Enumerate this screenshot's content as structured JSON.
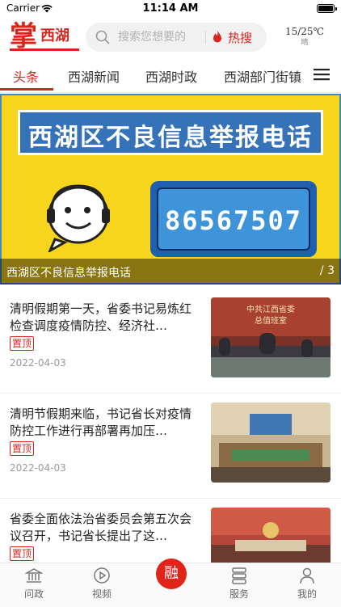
{
  "status_bar": {
    "carrier": "Carrier",
    "time": "11:14 AM"
  },
  "header": {
    "logo_mark": "掌",
    "logo_name": "西湖",
    "search_placeholder": "搜索您想要的",
    "hot_label": "热搜",
    "weather_temp": "15/25℃",
    "weather_cond": "晴"
  },
  "tabs": [
    {
      "label": "头条",
      "active": true
    },
    {
      "label": "西湖新闻",
      "active": false
    },
    {
      "label": "西湖时政",
      "active": false
    },
    {
      "label": "西湖部门街镇",
      "active": false
    }
  ],
  "banner": {
    "title": "西湖区不良信息举报电话",
    "phone": "86567507",
    "caption": "西湖区不良信息举报电话",
    "counter": "/ 3"
  },
  "news": [
    {
      "title": "清明假期第一天，省委书记易炼红检查调度疫情防控、经济社…",
      "badge": "置顶",
      "date": "2022-04-03",
      "thumb_caption": "中共江西省委\n总值班室"
    },
    {
      "title": "清明节假期来临，书记省长对疫情防控工作进行再部署再加压…",
      "badge": "置顶",
      "date": "2022-04-03"
    },
    {
      "title": "省委全面依法治省委员会第五次会议召开，书记省长提出了这…",
      "badge": "置顶",
      "date": ""
    }
  ],
  "tabbar": [
    {
      "label": "问政",
      "icon": "government-building-icon"
    },
    {
      "label": "视频",
      "icon": "play-icon"
    },
    {
      "label": "融",
      "icon": "center-button"
    },
    {
      "label": "服务",
      "icon": "services-list-icon"
    },
    {
      "label": "我的",
      "icon": "profile-icon"
    }
  ],
  "colors": {
    "accent": "#d9251d",
    "banner_bg": "#f7d51d",
    "banner_blue": "#3672b8"
  }
}
